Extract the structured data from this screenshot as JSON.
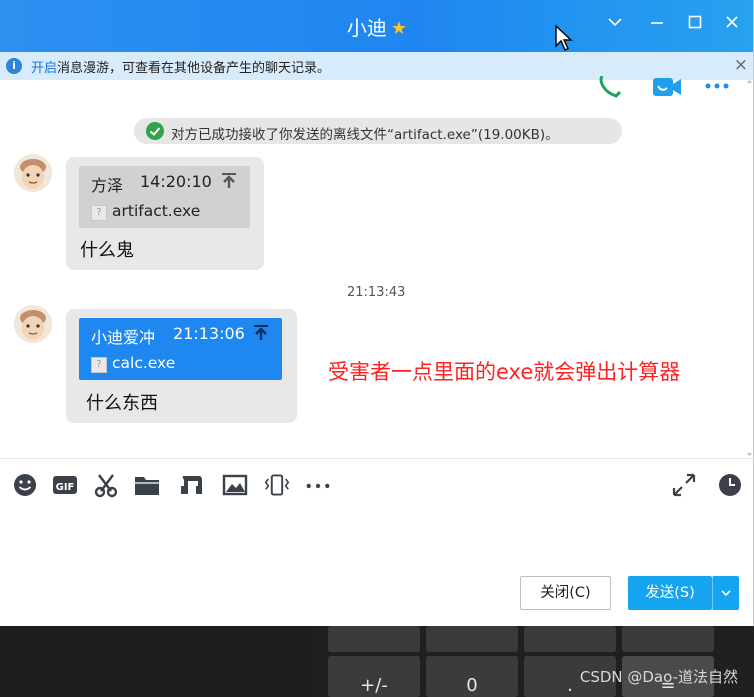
{
  "window": {
    "title": "小迪",
    "controls": [
      "chevron-down-icon",
      "minimize-icon",
      "maximize-icon",
      "close-icon"
    ]
  },
  "notice": {
    "link": "开启",
    "text": "消息漫游，可查看在其他设备产生的聊天记录。",
    "close": "×"
  },
  "system_message": "对方已成功接收了你发送的离线文件“artifact.exe”(19.00KB)。",
  "messages": [
    {
      "sender": "方泽",
      "time": "14:20:10",
      "file_name": "artifact.exe",
      "text": "什么鬼",
      "file_icon": "?"
    },
    {
      "sender": "小迪爱冲",
      "time": "21:13:06",
      "file_name": "calc.exe",
      "text": "什么东西",
      "file_icon": "?"
    }
  ],
  "timestamp": "21:13:43",
  "annotation": "受害者一点里面的exe就会弹出计算器",
  "toolbar_icons": [
    "emoji-icon",
    "gif-icon",
    "scissors-icon",
    "folder-icon",
    "music-icon",
    "image-icon",
    "shake-icon",
    "more-icon",
    "expand-icon",
    "history-clock-icon"
  ],
  "buttons": {
    "close": "关闭(C)",
    "send": "发送(S)",
    "send_menu": "∨"
  },
  "calculator": {
    "keys": [
      "+/-",
      "0",
      ".",
      "="
    ]
  },
  "watermark": "CSDN @Dao-道法自然",
  "colors": {
    "titlebar": "#2c90f0",
    "notice_bg": "#d7ebfb",
    "sent_file_card": "#1e87f0",
    "send_button": "#14a4f0",
    "annotation": "#ff2222"
  }
}
